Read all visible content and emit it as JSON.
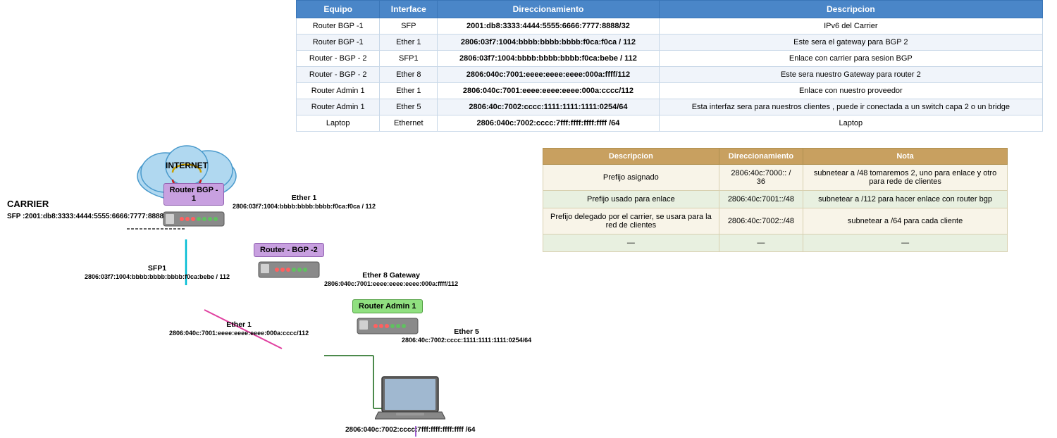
{
  "table": {
    "headers": [
      "Equipo",
      "Interface",
      "Direccionamiento",
      "Descripcion"
    ],
    "rows": [
      {
        "equipo": "Router BGP -1",
        "interface": "SFP",
        "direccionamiento": "2001:db8:3333:4444:5555:6666:7777:8888/32",
        "descripcion": "IPv6 del Carrier"
      },
      {
        "equipo": "Router BGP -1",
        "interface": "Ether 1",
        "direccionamiento": "2806:03f7:1004:bbbb:bbbb:bbbb:f0ca:f0ca / 112",
        "descripcion": "Este sera el gateway para BGP 2"
      },
      {
        "equipo": "Router - BGP - 2",
        "interface": "SFP1",
        "direccionamiento": "2806:03f7:1004:bbbb:bbbb:bbbb:f0ca:bebe / 112",
        "descripcion": "Enlace con carrier para sesion BGP"
      },
      {
        "equipo": "Router - BGP - 2",
        "interface": "Ether 8",
        "direccionamiento": "2806:040c:7001:eeee:eeee:eeee:000a:ffff/112",
        "descripcion": "Este sera nuestro Gateway para router 2"
      },
      {
        "equipo": "Router Admin 1",
        "interface": "Ether 1",
        "direccionamiento": "2806:040c:7001:eeee:eeee:eeee:000a:cccc/112",
        "descripcion": "Enlace con nuestro proveedor"
      },
      {
        "equipo": "Router Admin 1",
        "interface": "Ether 5",
        "direccionamiento": "2806:40c:7002:cccc:1111:1111:1111:0254/64",
        "descripcion": "Esta interfaz sera para nuestros clientes , puede ir conectada a un switch capa 2 o un bridge"
      },
      {
        "equipo": "Laptop",
        "interface": "Ethernet",
        "direccionamiento": "2806:040c:7002:cccc:7fff:ffff:ffff:ffff /64",
        "descripcion": "Laptop"
      }
    ]
  },
  "second_table": {
    "headers": [
      "Descripcion",
      "Direccionamiento",
      "Nota"
    ],
    "rows": [
      {
        "descripcion": "Prefijo asignado",
        "direccionamiento": "2806:40c:7000:: / 36",
        "nota": "subnetear a /48  tomaremos 2, uno para enlace y otro para rede de clientes"
      },
      {
        "descripcion": "Prefijo usado para enlace",
        "direccionamiento": "2806:40c:7001::/48",
        "nota": "subnetear a /112 para hacer enlace con router bgp"
      },
      {
        "descripcion": "Prefijo delegado por el carrier, se usara para la red de clientes",
        "direccionamiento": "2806:40c:7002::/48",
        "nota": "subnetear a /64 para cada cliente"
      },
      {
        "descripcion": "—",
        "direccionamiento": "—",
        "nota": "—"
      }
    ]
  },
  "diagram": {
    "internet_label": "INTERNET",
    "carrier_label": "CARRIER",
    "carrier_sfp": "SFP :2001:db8:3333:4444:5555:6666:7777:8888/32",
    "router_bgp1_label": "Router BGP -\n1",
    "router_bgp2_label": "Router - BGP -2",
    "router_admin1_label": "Router Admin 1",
    "ether1_bgp1": "Ether 1",
    "addr_ether1_bgp1": "2806:03f7:1004:bbbb:bbbb:bbbb:f0ca:f0ca / 112",
    "sfp1_bgp2": "SFP1",
    "addr_sfp1_bgp2": "2806:03f7:1004:bbbb:bbbb:bbbb:f0ca:bebe / 112",
    "ether8_bgp2": "Ether 8 Gateway",
    "addr_ether8_bgp2": "2806:040c:7001:eeee:eeee:eeee:000a:ffff/112",
    "ether1_admin": "Ether 1",
    "addr_ether1_admin": "2806:040c:7001:eeee:eeee:eeee:000a:cccc/112",
    "ether5_admin": "Ether 5",
    "addr_ether5_admin": "2806:40c:7002:cccc:1111:1111:1111:0254/64",
    "laptop_addr": "2806:040c:7002:cccc:7fff:ffff:ffff:ffff /64"
  }
}
